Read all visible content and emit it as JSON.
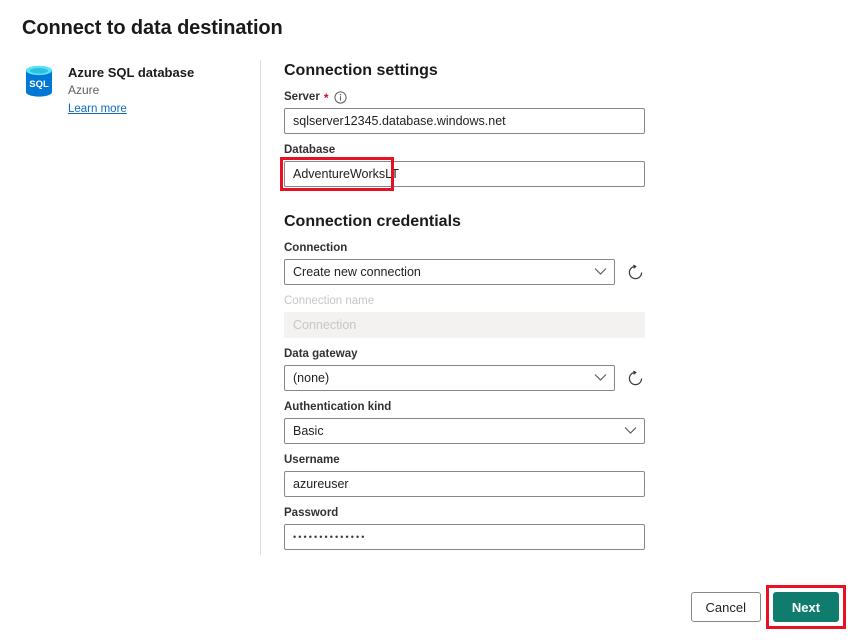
{
  "dialog": {
    "title": "Connect to data destination"
  },
  "connector": {
    "icon": "sql-database-icon",
    "name": "Azure SQL database",
    "publisher": "Azure",
    "learn_more_label": "Learn more"
  },
  "connection_settings": {
    "heading": "Connection settings",
    "server": {
      "label": "Server",
      "required_marker": "*",
      "info_icon": "info-icon",
      "value": "sqlserver12345.database.windows.net"
    },
    "database": {
      "label": "Database",
      "value": "AdventureWorksLT",
      "highlighted": true
    }
  },
  "connection_credentials": {
    "heading": "Connection credentials",
    "connection": {
      "label": "Connection",
      "value": "Create new connection",
      "refresh_icon": "refresh-icon"
    },
    "connection_name": {
      "label": "Connection name",
      "placeholder": "Connection",
      "value": "",
      "disabled": true
    },
    "data_gateway": {
      "label": "Data gateway",
      "value": "(none)",
      "refresh_icon": "refresh-icon"
    },
    "authentication_kind": {
      "label": "Authentication kind",
      "value": "Basic"
    },
    "username": {
      "label": "Username",
      "value": "azureuser"
    },
    "password": {
      "label": "Password",
      "value": "••••••••••••••"
    }
  },
  "footer": {
    "cancel_label": "Cancel",
    "next_label": "Next",
    "next_highlighted": true
  },
  "colors": {
    "primary_button": "#107c6e",
    "annotation": "#e81123",
    "link": "#0f6cbd",
    "required": "#c50f1f",
    "icon_blue": "#0078d4"
  }
}
